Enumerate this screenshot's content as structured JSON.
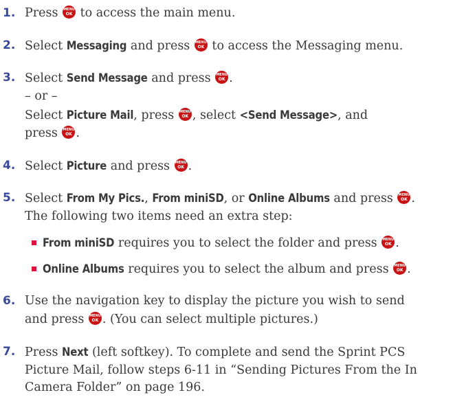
{
  "steps": [
    {
      "num": "1.",
      "parts": [
        "Press ",
        "to access the main menu."
      ]
    },
    {
      "num": "2.",
      "parts": [
        "Select ",
        "Messaging",
        " and press ",
        "to access the Messaging menu."
      ]
    },
    {
      "num": "3.",
      "parts": [
        "Select ",
        "Send Message",
        " and press ",
        "."
      ],
      "or": "– or –",
      "alt": [
        "Select ",
        "Picture Mail",
        ", press ",
        ", select ",
        "<Send Message>",
        ", and",
        "press ",
        "."
      ]
    },
    {
      "num": "4.",
      "parts": [
        "Select ",
        "Picture",
        " and press ",
        "."
      ]
    },
    {
      "num": "5.",
      "parts": [
        "Select ",
        "From My Pics.",
        ", ",
        "From miniSD",
        ", or ",
        "Online Albums",
        " and press ",
        "."
      ],
      "line2": "The following two items need an extra step:",
      "bullets": [
        {
          "bold": "From miniSD",
          "text": " requires you to select the folder and press ",
          "end": "."
        },
        {
          "bold": "Online Albums",
          "text": " requires you to select the album and press ",
          "end": "."
        }
      ]
    },
    {
      "num": "6.",
      "parts": [
        "Use the navigation key to display the picture you wish to send",
        "and press ",
        ". (You can select multiple pictures.)"
      ]
    },
    {
      "num": "7.",
      "parts": [
        "Press ",
        "Next",
        " (left softkey). To complete and send the Sprint PCS",
        "Picture Mail, follow steps 6-11 in “Sending Pictures From the In",
        "Camera Folder” on page 196."
      ]
    }
  ],
  "icons": {
    "menu_key": "menu-ok-key-icon",
    "menu_key_color": "#c71313",
    "number_color": "#3a4a9a",
    "bullet_color": "#e0123f"
  }
}
